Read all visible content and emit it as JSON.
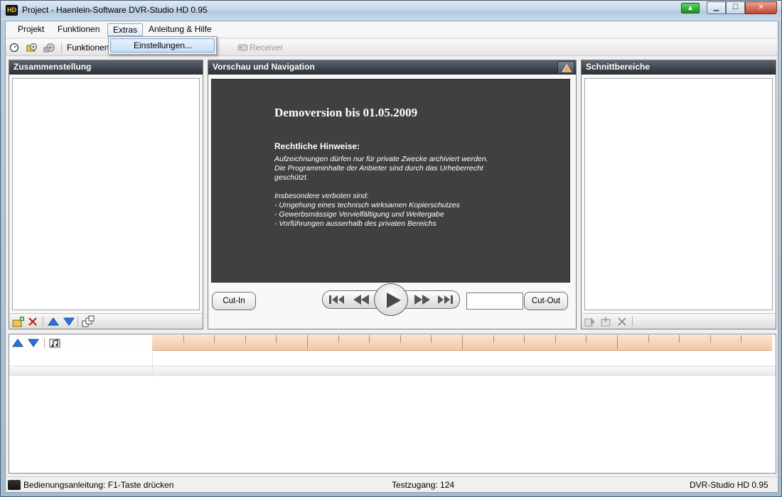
{
  "window": {
    "title": "Project - Haenlein-Software DVR-Studio HD 0.95",
    "app_icon_label": "HD"
  },
  "menu": {
    "items": [
      "Projekt",
      "Funktionen",
      "Extras",
      "Anleitung & Hilfe"
    ],
    "open_index": 2,
    "dropdown_item": "Einstellungen..."
  },
  "toolbar": {
    "funktionen_label": "Funktionen",
    "receiver_label": "Receiver"
  },
  "panels": {
    "left_title": "Zusammenstellung",
    "center_title": "Vorschau und Navigation",
    "right_title": "Schnittbereiche"
  },
  "preview": {
    "demo_title": "Demoversion bis 01.05.2009",
    "legal_title": "Rechtliche Hinweise:",
    "legal_text": "Aufzeichnungen dürfen nur für private Zwecke archiviert werden.\nDie Programminhalte der Anbieter sind durch das Urheberrecht\ngeschützt.\n\nInsbesondere verboten sind:\n- Umgehung eines technisch wirksamen Kopierschutzes\n- Gewerbsmässige Vervielfältigung und Weitergabe\n- Vorführungen ausserhalb des privaten Bereichs"
  },
  "controls": {
    "cut_in": "Cut-In",
    "cut_out": "Cut-Out",
    "timecode_value": ""
  },
  "status": {
    "help": "Bedienungsanleitung: F1-Taste drücken",
    "account": "Testzugang: 124",
    "product": "DVR-Studio HD 0.95"
  },
  "colors": {
    "panel_header": "#3d444d",
    "preview_bg": "#404040",
    "ruler": "#f3c7a6",
    "menu_highlight": "#c8dff6"
  }
}
